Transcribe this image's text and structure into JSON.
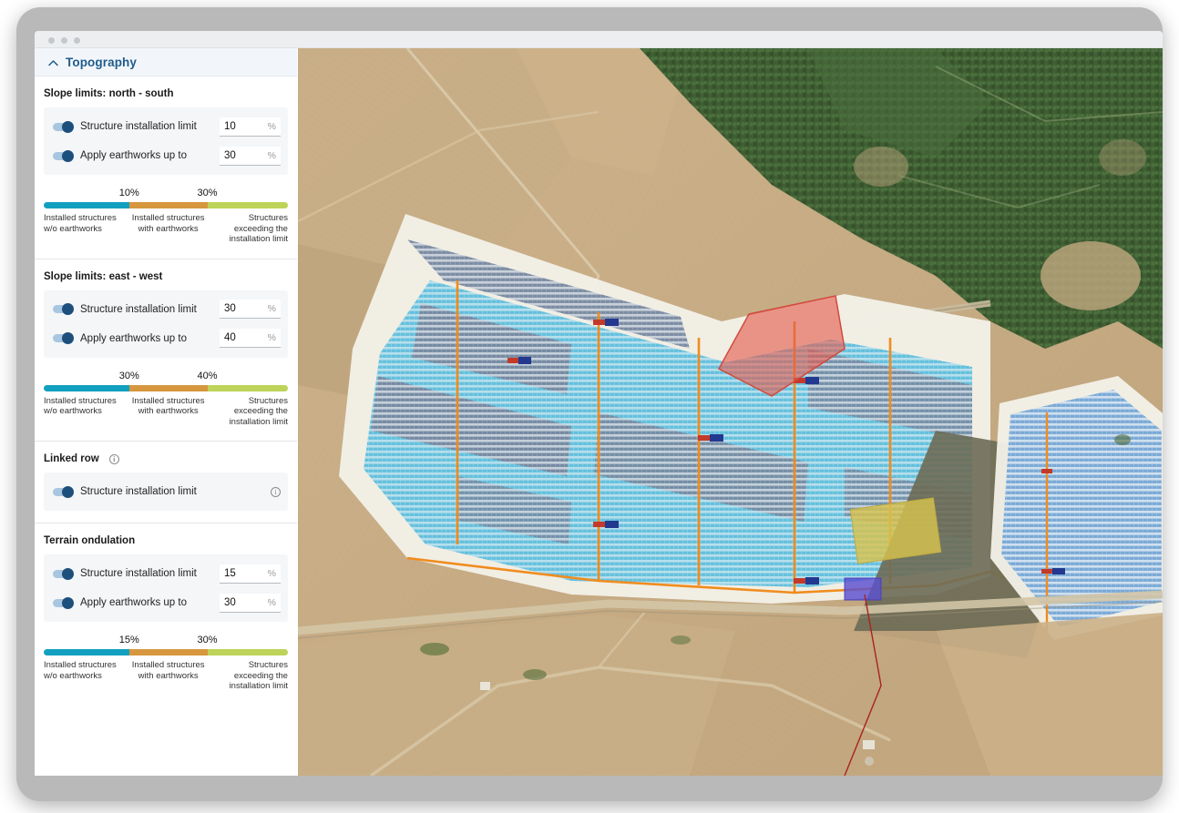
{
  "window": {
    "traffic_dots": 3
  },
  "panel": {
    "title": "Topography",
    "collapse_icon": "chevron-up-icon"
  },
  "sections": [
    {
      "id": "slope-north-south",
      "title": "Slope limits: north - south",
      "has_info": false,
      "rows": [
        {
          "label": "Structure installation limit",
          "value": "10",
          "unit": "%",
          "toggle_on": true,
          "has_info": false
        },
        {
          "label": "Apply earthworks up to",
          "value": "30",
          "unit": "%",
          "toggle_on": true,
          "has_info": false
        }
      ],
      "legend": {
        "mark_low": "10%",
        "mark_high": "30%",
        "label_1": "Installed structures w/o earthworks",
        "label_2": "Installed structures with earthworks",
        "label_3": "Structures exceeding the installation limit",
        "color_1": "#13a0c0",
        "color_2": "#d6973f",
        "color_3": "#bed359"
      }
    },
    {
      "id": "slope-east-west",
      "title": "Slope limits: east - west",
      "has_info": false,
      "rows": [
        {
          "label": "Structure installation limit",
          "value": "30",
          "unit": "%",
          "toggle_on": true,
          "has_info": false
        },
        {
          "label": "Apply earthworks up to",
          "value": "40",
          "unit": "%",
          "toggle_on": true,
          "has_info": false
        }
      ],
      "legend": {
        "mark_low": "30%",
        "mark_high": "40%",
        "label_1": "Installed structures w/o earthworks",
        "label_2": "Installed structures with earthworks",
        "label_3": "Structures exceeding the installation limit",
        "color_1": "#13a0c0",
        "color_2": "#d6973f",
        "color_3": "#bed359"
      }
    },
    {
      "id": "linked-row",
      "title": "Linked row",
      "has_info": true,
      "rows": [
        {
          "label": "Structure installation limit",
          "value": null,
          "unit": null,
          "toggle_on": true,
          "has_info": true
        }
      ],
      "legend": null
    },
    {
      "id": "terrain-ondulation",
      "title": "Terrain ondulation",
      "has_info": false,
      "rows": [
        {
          "label": "Structure installation limit",
          "value": "15",
          "unit": "%",
          "toggle_on": true,
          "has_info": false
        },
        {
          "label": "Apply earthworks up to",
          "value": "30",
          "unit": "%",
          "toggle_on": true,
          "has_info": false
        }
      ],
      "legend": {
        "mark_low": "15%",
        "mark_high": "30%",
        "label_1": "Installed structures w/o earthworks",
        "label_2": "Installed structures with earthworks",
        "label_3": "Structures exceeding the installation limit",
        "color_1": "#13a0c0",
        "color_2": "#d6973f",
        "color_3": "#bed359"
      }
    }
  ],
  "map": {
    "type": "satellite-aerial",
    "layers": [
      {
        "name": "cropland-fields",
        "color": "#c5a981"
      },
      {
        "name": "forest",
        "color": "#3d5c31"
      },
      {
        "name": "solar-array-light",
        "color": "#79c8e0"
      },
      {
        "name": "solar-array-dark",
        "color": "#7e90ab"
      },
      {
        "name": "array-boundary",
        "color": "#f2f0e8"
      },
      {
        "name": "cable-trench",
        "color": "#f08c1e"
      },
      {
        "name": "exclusion-zone",
        "color": "#e35a4e"
      },
      {
        "name": "substation",
        "color": "#d7c24e"
      },
      {
        "name": "inverter-block",
        "color": "#5a4fd0"
      },
      {
        "name": "transmission-line",
        "color": "#a8231e"
      }
    ]
  },
  "colors": {
    "accent": "#1f5c8b",
    "panel_header_bg": "#f2f6fa",
    "group_bg": "#f4f6f8",
    "toggle_track": "#a9c6e0",
    "toggle_knob": "#1c4f7c"
  }
}
